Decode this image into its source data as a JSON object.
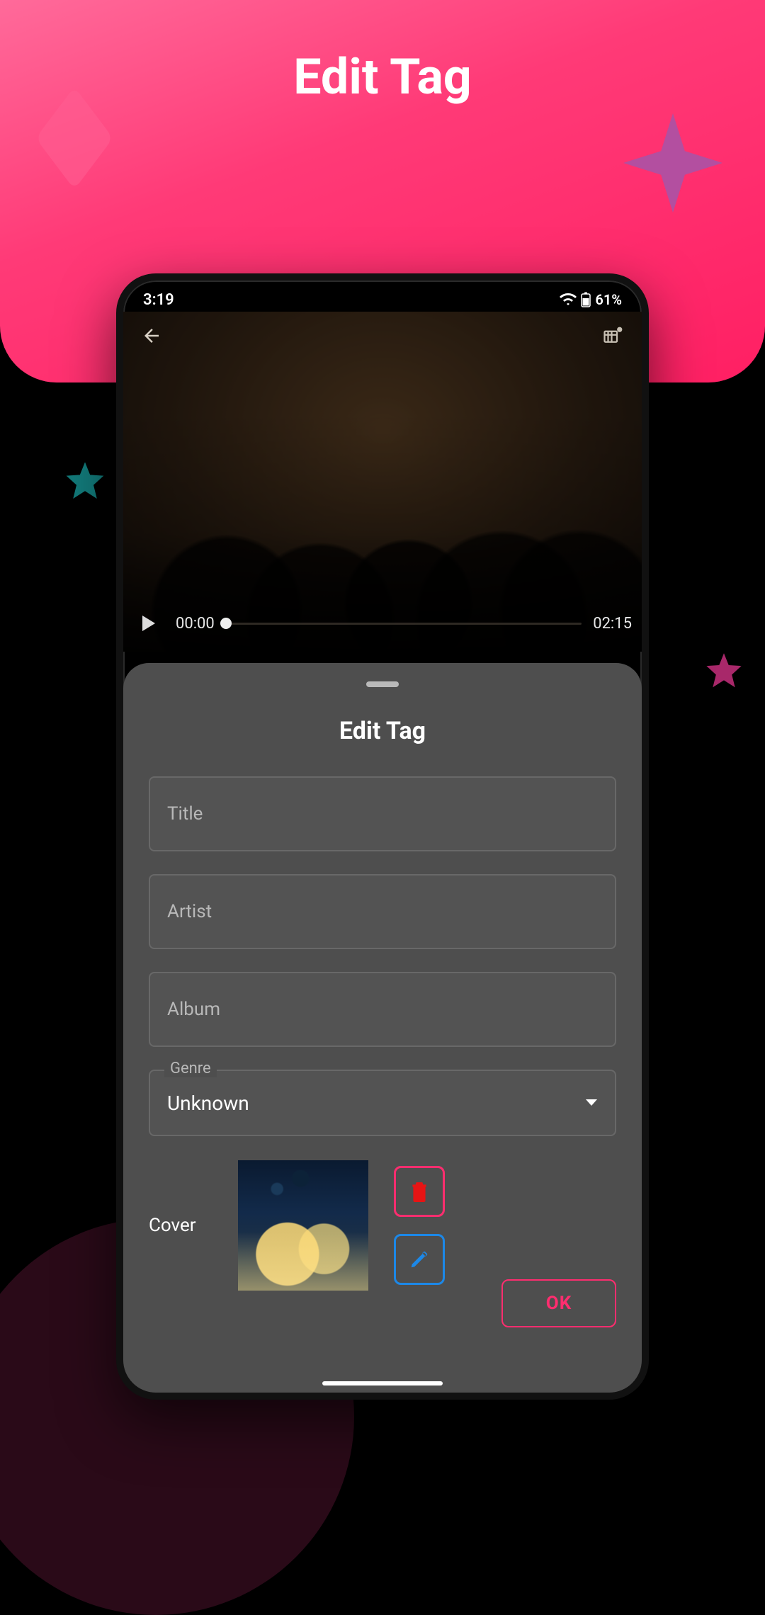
{
  "marketing_title": "Edit Tag",
  "status": {
    "time": "3:19",
    "battery_pct": "61%"
  },
  "video": {
    "elapsed": "00:00",
    "duration": "02:15"
  },
  "sheet": {
    "title": "Edit Tag",
    "title_label": "Title",
    "artist_label": "Artist",
    "album_label": "Album",
    "genre_label": "Genre",
    "genre_value": "Unknown",
    "cover_label": "Cover",
    "ok_label": "OK"
  }
}
